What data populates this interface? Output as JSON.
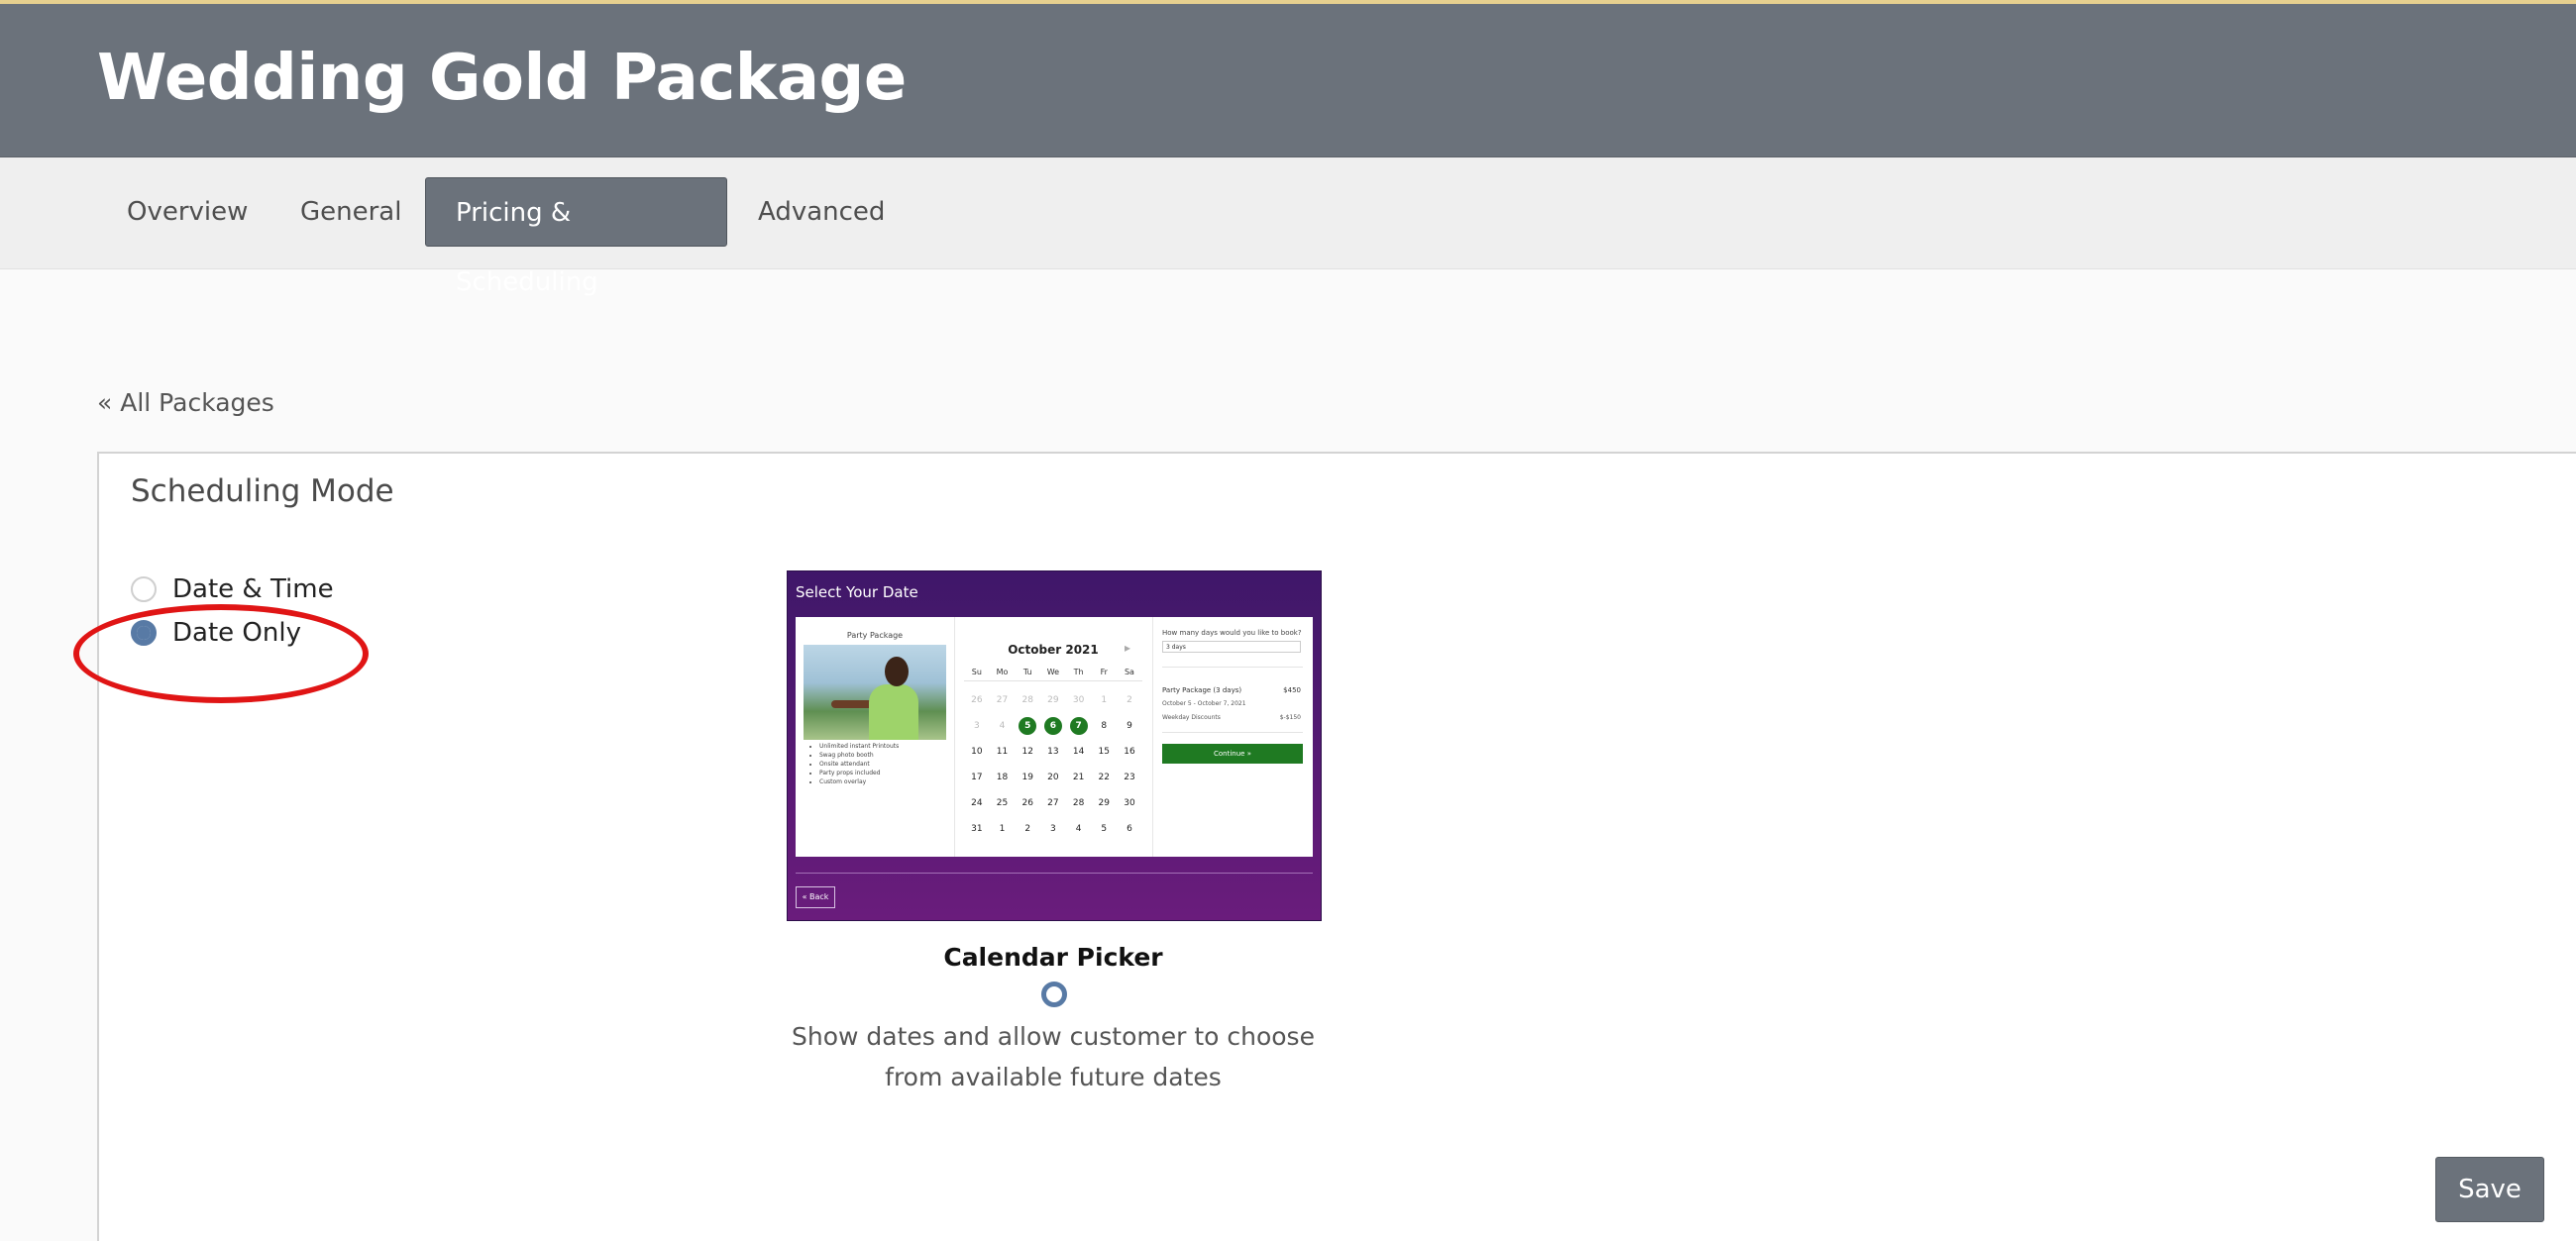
{
  "header": {
    "title": "Wedding Gold Package"
  },
  "tabs": [
    {
      "label": "Overview"
    },
    {
      "label": "General"
    },
    {
      "label": "Pricing & Scheduling",
      "active": true
    },
    {
      "label": "Advanced"
    }
  ],
  "back_link": "« All Packages",
  "scheduling": {
    "title": "Scheduling Mode",
    "options": [
      {
        "label": "Date & Time",
        "selected": false
      },
      {
        "label": "Date Only",
        "selected": true
      }
    ]
  },
  "preview": {
    "title": "Select Your Date",
    "package_name": "Party Package",
    "features": [
      "Unlimited instant Printouts",
      "Swag photo booth",
      "Onsite attendant",
      "Party props included",
      "Custom overlay"
    ],
    "month": "October 2021",
    "weekdays": [
      "Su",
      "Mo",
      "Tu",
      "We",
      "Th",
      "Fr",
      "Sa"
    ],
    "weeks": [
      [
        "26",
        "27",
        "28",
        "29",
        "30",
        "1",
        "2"
      ],
      [
        "3",
        "4",
        "5",
        "6",
        "7",
        "8",
        "9"
      ],
      [
        "10",
        "11",
        "12",
        "13",
        "14",
        "15",
        "16"
      ],
      [
        "17",
        "18",
        "19",
        "20",
        "21",
        "22",
        "23"
      ],
      [
        "24",
        "25",
        "26",
        "27",
        "28",
        "29",
        "30"
      ],
      [
        "31",
        "1",
        "2",
        "3",
        "4",
        "5",
        "6"
      ]
    ],
    "question": "How many days would you like to book?",
    "days_value": "3 days",
    "line_item": "Party Package (3 days)",
    "line_price": "$450",
    "date_range": "October 5 - October 7, 2021",
    "discount_label": "Weekday Discounts",
    "discount_value": "$-$150",
    "continue_label": "Continue »",
    "back_label": "« Back"
  },
  "picker": {
    "title": "Calendar Picker",
    "description_line1": "Show dates and allow customer to choose",
    "description_line2": "from available future dates"
  },
  "save_label": "Save",
  "colors": {
    "header": "#6b727b",
    "accent": "#587aa5",
    "highlight": "#e01515",
    "preview_bg": "#4a1870",
    "calendar_selected": "#1f7a22"
  }
}
